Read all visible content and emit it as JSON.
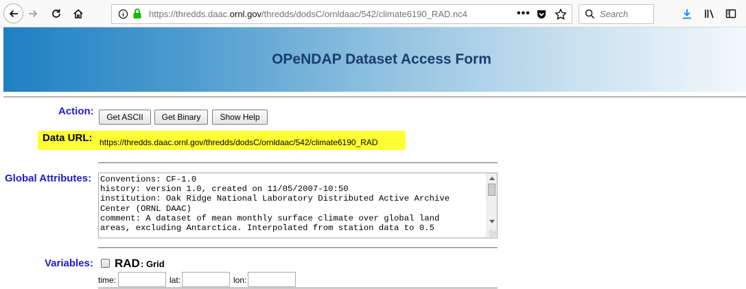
{
  "browser": {
    "url_prefix": "https://thredds.daac.",
    "url_host": "ornl.gov",
    "url_rest": "/thredds/dodsC/ornldaac/542/climate6190_RAD.nc4",
    "search_placeholder": "Search",
    "icons": [
      "back-icon",
      "forward-icon",
      "reload-icon",
      "home-icon",
      "info-icon",
      "lock-icon",
      "more-icon",
      "pocket-icon",
      "star-icon",
      "search-icon",
      "download-icon",
      "library-icon",
      "sidebar-icon"
    ]
  },
  "page": {
    "title": "OPeNDAP Dataset Access Form",
    "action_label": "Action:",
    "buttons": {
      "get_ascii": "Get ASCII",
      "get_binary": "Get Binary",
      "show_help": "Show Help"
    },
    "data_url_label": "Data URL:",
    "data_url_value": "https://thredds.daac.ornl.gov/thredds/dodsC/ornldaac/542/climate6190_RAD",
    "global_attributes_label": "Global Attributes:",
    "global_attributes_text": "Conventions: CF-1.0\nhistory: version 1.0, created on 11/05/2007-10:50\ninstitution: Oak Ridge National Laboratory Distributed Active Archive\nCenter (ORNL DAAC)\ncomment: A dataset of mean monthly surface climate over global land\nareas, excluding Antarctica. Interpolated from station data to 0.5",
    "variables_label": "Variables:",
    "variable": {
      "name": "RAD",
      "type": ": Grid",
      "dims": {
        "time": "time:",
        "lat": "lat:",
        "lon": "lon:"
      }
    }
  },
  "colors": {
    "label_blue": "#1c1ccc",
    "title_navy": "#1a3d6e",
    "highlight_yellow": "#ffff33",
    "banner_start": "#1f80c2"
  }
}
